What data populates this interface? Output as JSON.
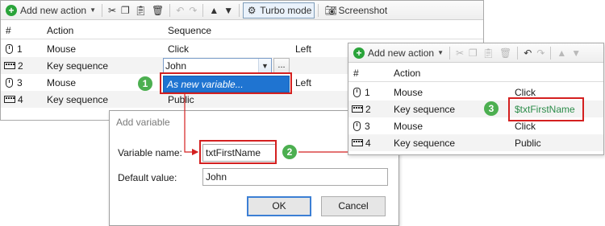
{
  "left_window": {
    "toolbar": {
      "add_new_action": "Add new action",
      "turbo_mode": "Turbo mode",
      "screenshot": "Screenshot"
    },
    "columns": [
      "#",
      "Action",
      "Sequence"
    ],
    "rows": [
      {
        "num": "1",
        "icon": "mouse-icon",
        "action": "Mouse",
        "sequence": "Click",
        "extra": "Left"
      },
      {
        "num": "2",
        "icon": "keyboard-icon",
        "action": "Key sequence",
        "sequence": "John",
        "extra": ""
      },
      {
        "num": "3",
        "icon": "mouse-icon",
        "action": "Mouse",
        "sequence": "",
        "extra": "Left"
      },
      {
        "num": "4",
        "icon": "keyboard-icon",
        "action": "Key sequence",
        "sequence": "Public",
        "extra": ""
      }
    ],
    "combo_value": "John",
    "ellipsis": "...",
    "dropdown_item": "As new variable..."
  },
  "right_window": {
    "toolbar": {
      "add_new_action": "Add new action"
    },
    "columns": [
      "#",
      "Action"
    ],
    "rows": [
      {
        "num": "1",
        "icon": "mouse-icon",
        "action": "Mouse",
        "sequence": "Click"
      },
      {
        "num": "2",
        "icon": "keyboard-icon",
        "action": "Key sequence",
        "sequence": "$txtFirstName"
      },
      {
        "num": "3",
        "icon": "mouse-icon",
        "action": "Mouse",
        "sequence": "Click"
      },
      {
        "num": "4",
        "icon": "keyboard-icon",
        "action": "Key sequence",
        "sequence": "Public"
      }
    ]
  },
  "dialog": {
    "title": "Add variable",
    "variable_name_label": "Variable name:",
    "variable_name_value": "txtFirstName",
    "default_value_label": "Default value:",
    "default_value_value": "John",
    "ok": "OK",
    "cancel": "Cancel"
  },
  "callouts": [
    "1",
    "2",
    "3"
  ],
  "colors": {
    "callout": "#4caf50",
    "highlight": "#d42020",
    "selection": "#1f74d1",
    "variable_text": "#2c8c4a"
  }
}
